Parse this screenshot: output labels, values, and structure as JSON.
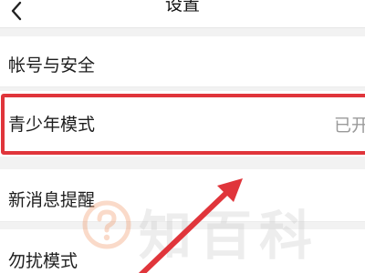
{
  "nav": {
    "title": "设置",
    "back_icon": "chevron-left-icon"
  },
  "settings": {
    "items": [
      {
        "label": "帐号与安全"
      },
      {
        "label": "青少年模式",
        "value": "已开"
      },
      {
        "label": "新消息提醒"
      },
      {
        "label": "勿扰模式"
      }
    ]
  },
  "annotation": {
    "highlight_color": "#e0353b",
    "arrow_color": "#e0353b"
  },
  "watermark": {
    "text": "知百科",
    "logo_icon": "question-mark-circle-icon"
  }
}
